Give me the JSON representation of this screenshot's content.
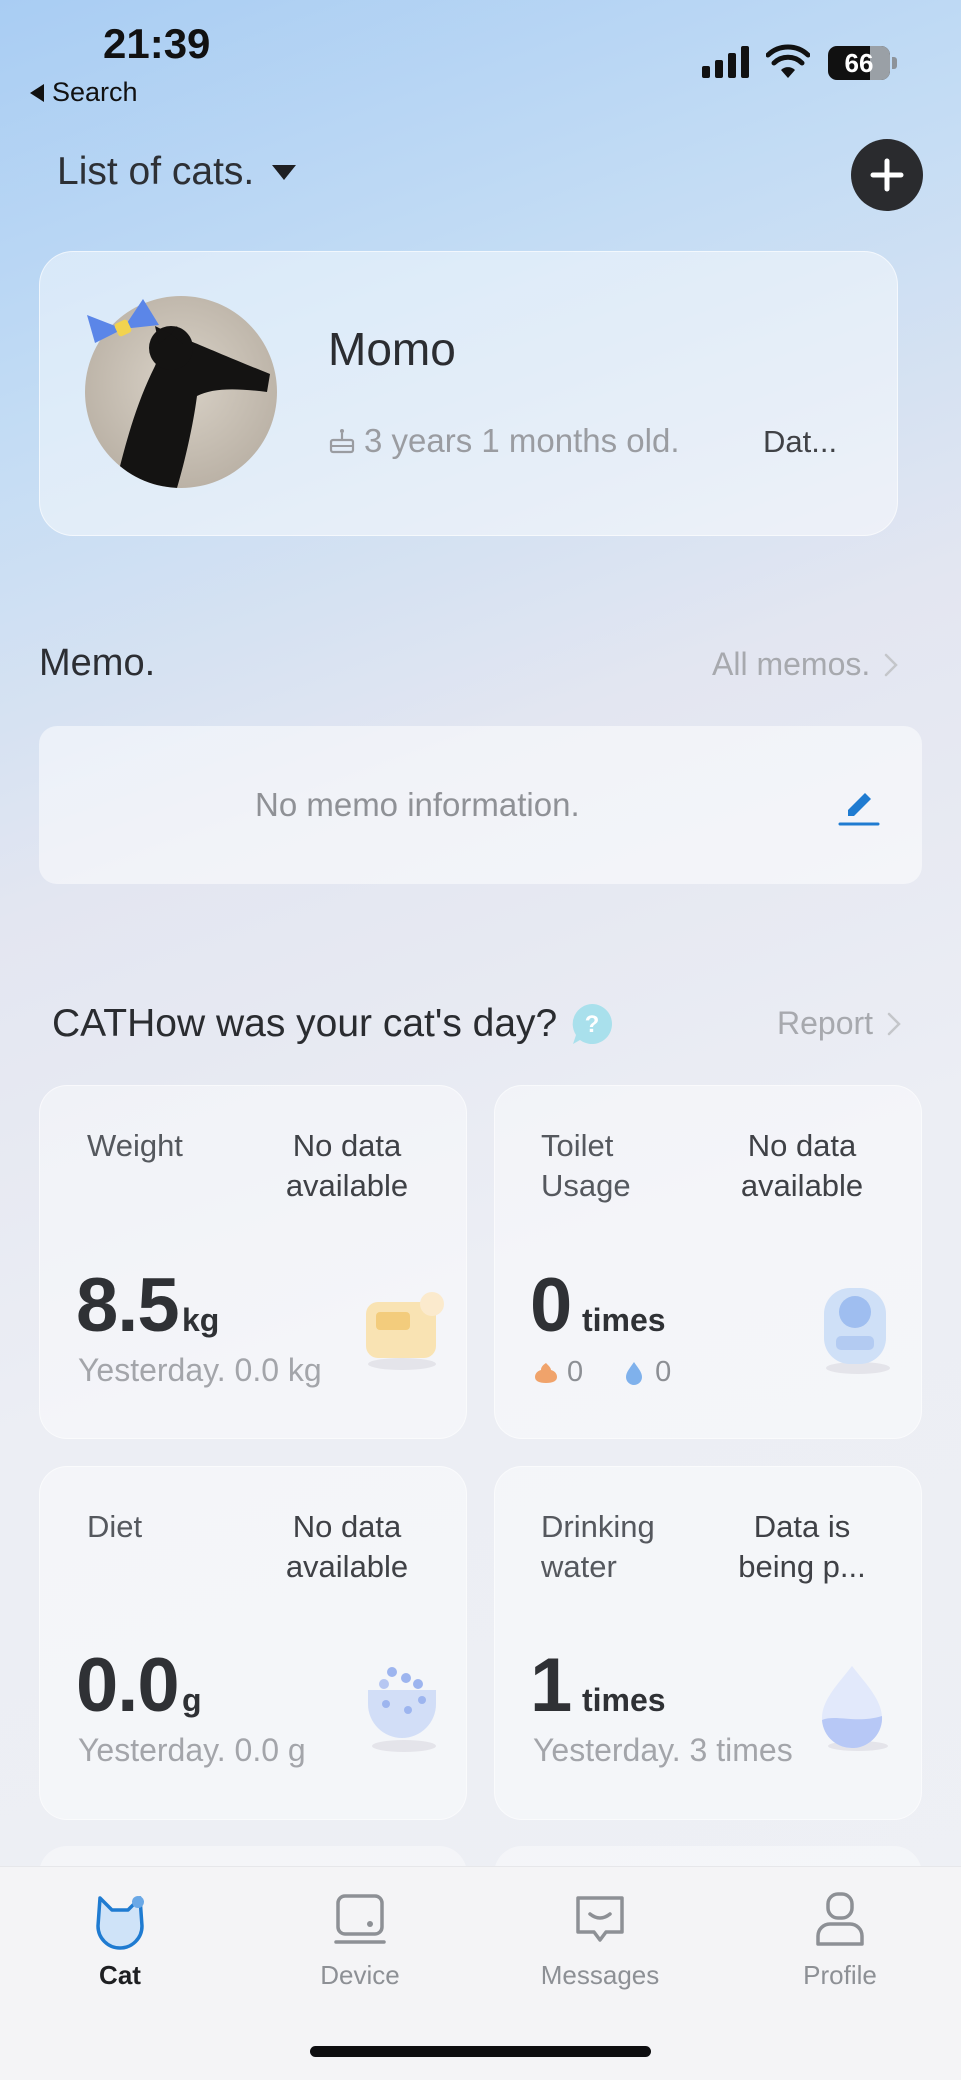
{
  "status_bar": {
    "time": "21:39",
    "back_label": "Search",
    "battery": "66"
  },
  "header": {
    "title": "List of cats.",
    "add_icon": "plus-icon"
  },
  "cat": {
    "name": "Momo",
    "age": "3 years 1 months old.",
    "data_label": "Dat..."
  },
  "memo": {
    "title": "Memo.",
    "all_link": "All memos.",
    "empty_text": "No memo information."
  },
  "daily": {
    "title": "CATHow was your cat's day?",
    "report_link": "Report",
    "tiles": [
      {
        "label": "Weight",
        "status": "No data available",
        "value": "8.5",
        "unit": "kg",
        "sub": "Yesterday. 0.0 kg"
      },
      {
        "label": "Toilet Usage",
        "status": "No data available",
        "value": "0",
        "unit": "times",
        "poop": "0",
        "pee": "0"
      },
      {
        "label": "Diet",
        "status": "No data available",
        "value": "0.0",
        "unit": "g",
        "sub": "Yesterday. 0.0 g"
      },
      {
        "label": "Drinking water",
        "status": "Data is being p...",
        "value": "1",
        "unit": "times",
        "sub": "Yesterday. 3 times"
      }
    ]
  },
  "nav": {
    "items": [
      {
        "label": "Cat",
        "icon": "cat-icon",
        "active": true
      },
      {
        "label": "Device",
        "icon": "device-icon"
      },
      {
        "label": "Messages",
        "icon": "messages-icon"
      },
      {
        "label": "Profile",
        "icon": "profile-icon"
      }
    ]
  },
  "colors": {
    "accent": "#1f7bd1",
    "dark_button": "#2a2b2e"
  }
}
